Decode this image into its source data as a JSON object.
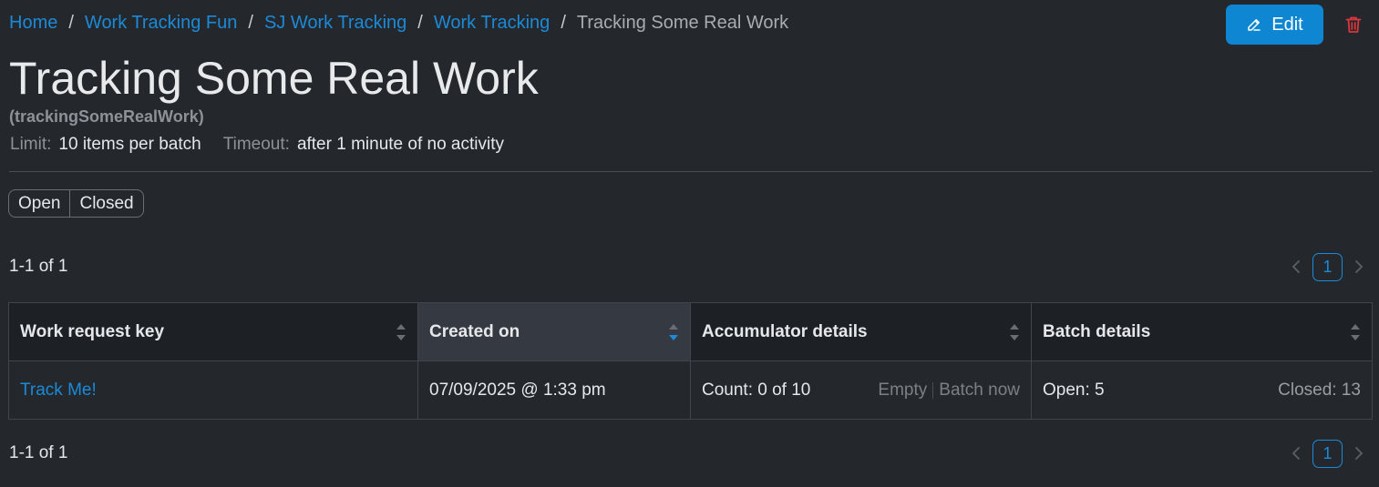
{
  "breadcrumb": {
    "items": [
      "Home",
      "Work Tracking Fun",
      "SJ Work Tracking",
      "Work Tracking"
    ],
    "current": "Tracking Some Real Work",
    "separator": "/"
  },
  "actions": {
    "edit_label": "Edit",
    "delete_icon": "trash-icon"
  },
  "header": {
    "title": "Tracking Some Real Work",
    "key": "(trackingSomeRealWork)",
    "limit_label": "Limit:",
    "limit_value": "10 items per batch",
    "timeout_label": "Timeout:",
    "timeout_value": "after 1 minute of no activity"
  },
  "filter": {
    "options": [
      "Open",
      "Closed"
    ]
  },
  "pagination": {
    "range_text": "1-1 of 1",
    "current_page": "1"
  },
  "table": {
    "columns": [
      "Work request key",
      "Created on",
      "Accumulator details",
      "Batch details"
    ],
    "sorted_column": "Created on",
    "rows": [
      {
        "key": "Track Me!",
        "created_on": "07/09/2025 @ 1:33 pm",
        "accumulator_count": "Count: 0 of 10",
        "accumulator_actions": [
          "Empty",
          "Batch now"
        ],
        "batch_open": "Open: 5",
        "batch_closed": "Closed: 13"
      }
    ]
  },
  "colors": {
    "background": "#24282d",
    "accent": "#0e86d1",
    "link": "#1b8ad7",
    "danger": "#d9363e"
  }
}
